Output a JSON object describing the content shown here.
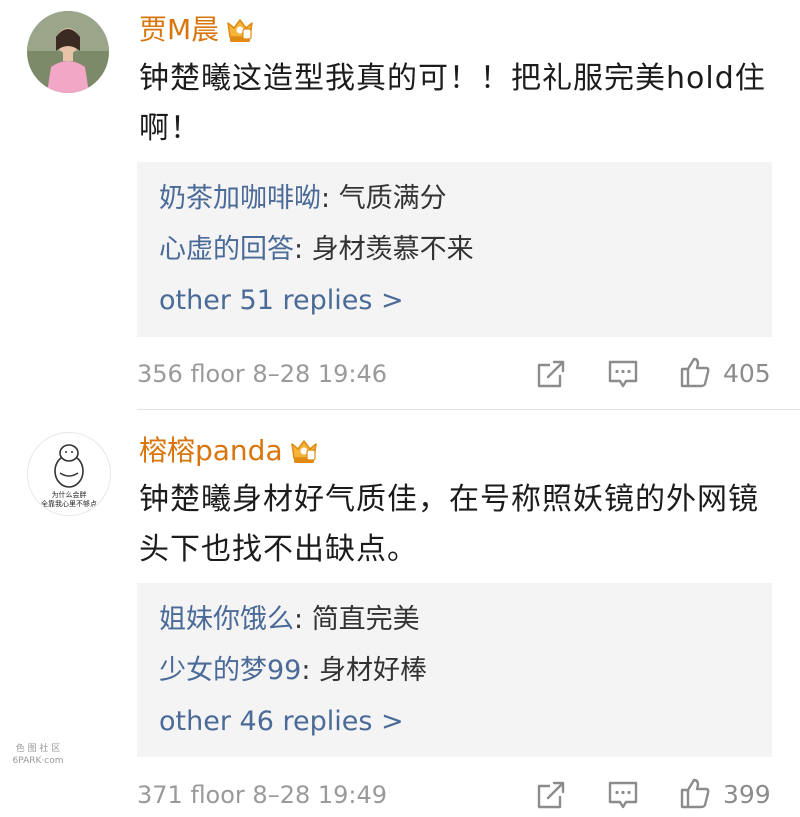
{
  "comments": [
    {
      "username": "贾M晨",
      "text": "钟楚曦这造型我真的可！！把礼服完美hold住啊！",
      "replies": [
        {
          "name": "奶茶加咖啡呦",
          "sep": ": ",
          "content": "气质满分"
        },
        {
          "name": "心虚的回答",
          "sep": ": ",
          "content": "身材羡慕不来"
        }
      ],
      "more_replies": "other 51 replies >",
      "meta": "356 floor 8–28 19:46",
      "likes": "405"
    },
    {
      "username": "榕榕panda",
      "text": "钟楚曦身材好气质佳，在号称照妖镜的外网镜头下也找不出缺点。",
      "replies": [
        {
          "name": "姐妹你饿么",
          "sep": ": ",
          "content": "简直完美"
        },
        {
          "name": "少女的梦99",
          "sep": ": ",
          "content": "身材好棒"
        }
      ],
      "more_replies": "other 46 replies >",
      "meta": "371 floor 8–28 19:49",
      "likes": "399"
    }
  ],
  "avatar2_caption": [
    "为什么会胖",
    "全靠我心里不够点"
  ],
  "watermark": [
    "色 图 社 区",
    "6PARK·com"
  ],
  "colors": {
    "username": "#d8760d",
    "reply_name": "#4a6a98",
    "reply_bg": "#f4f4f4",
    "meta": "#9a9a9a"
  },
  "icons": {
    "vip": "crown-vip-icon",
    "share": "share-icon",
    "comment": "comment-icon",
    "like": "thumbs-up-icon"
  }
}
